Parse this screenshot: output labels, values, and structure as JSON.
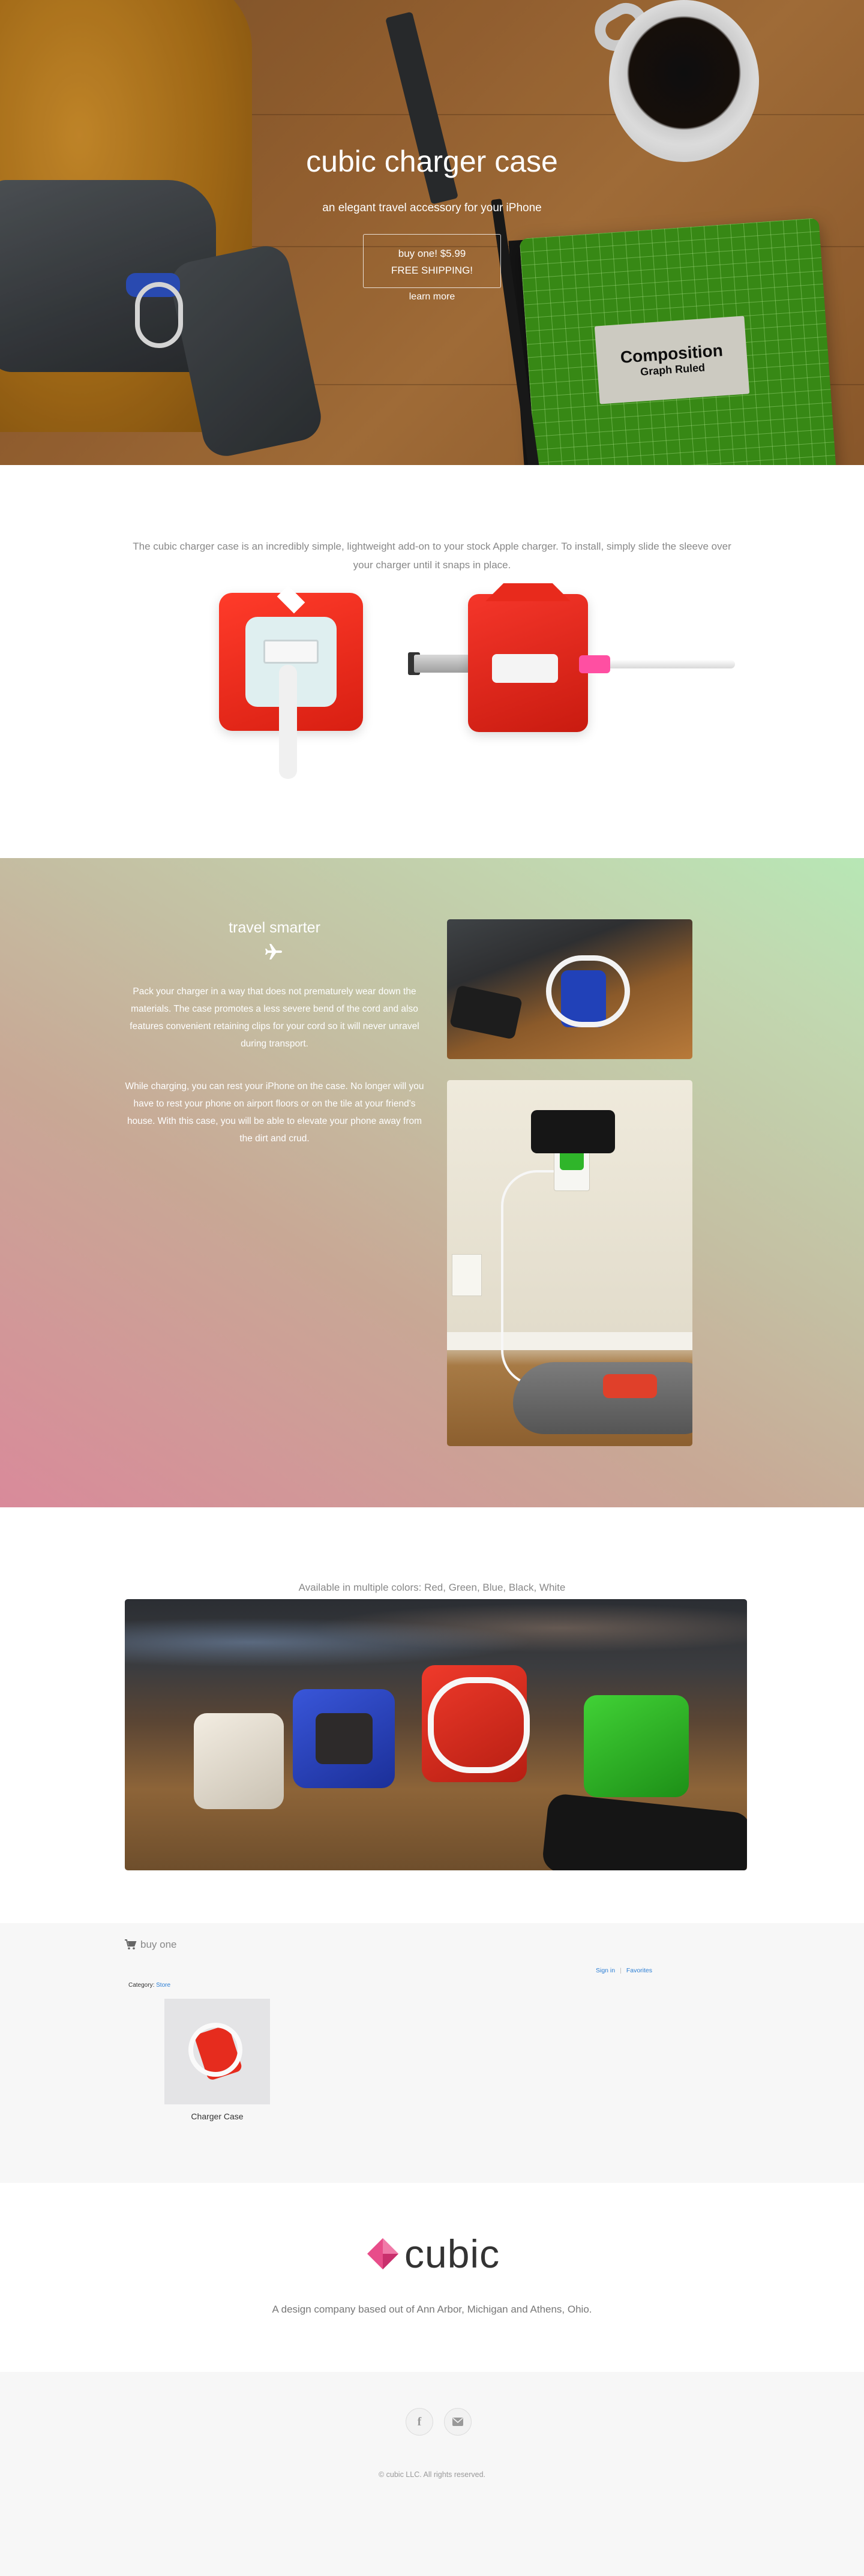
{
  "hero": {
    "title": "cubic charger case",
    "subtitle": "an elegant travel accessory for your iPhone",
    "buy_line1": "buy one! $5.99",
    "buy_line2": "FREE SHIPPING!",
    "learn_more": "learn more",
    "notebook_label_1": "Composition",
    "notebook_label_2": "Graph Ruled"
  },
  "intro": {
    "text": "The cubic charger case is an incredibly simple, lightweight add-on to your stock Apple charger. To install, simply slide the sleeve over your charger until it snaps in place."
  },
  "travel": {
    "title": "travel smarter",
    "icon": "plane-icon",
    "paragraph1": "Pack your charger in a way that does not prematurely wear down the materials. The case promotes a less severe bend of the cord and also features convenient retaining clips for your cord so it will never unravel during transport.",
    "paragraph2": "While charging, you can rest your iPhone on the case. No longer will you have to rest your phone on airport floors or on the tile at your friend's house. With this case, you will be able to elevate your phone away from the dirt and crud."
  },
  "colors": {
    "caption": "Available in multiple colors: Red, Green, Blue, Black, White",
    "swatches": [
      "#f3ede2",
      "#2d46c9",
      "#e0301f",
      "#33c22a"
    ]
  },
  "store": {
    "heading": "buy one",
    "icon": "shopping-cart-icon",
    "sign_in": "Sign in",
    "separator": "|",
    "favorites": "Favorites",
    "category_label": "Category:",
    "category_value": "Store",
    "product_name": "Charger Case"
  },
  "about": {
    "logo_text": "cubic",
    "logo_color": "#e84d8a",
    "tagline": "A design company based out of Ann Arbor, Michigan and Athens, Ohio."
  },
  "footer": {
    "facebook_glyph": "f",
    "copyright": "© cubic LLC. All rights reserved."
  }
}
